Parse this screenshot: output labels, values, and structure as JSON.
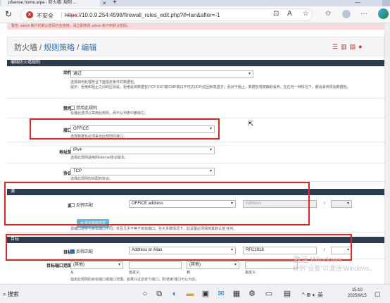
{
  "browser": {
    "tab_title": "pfsense.home.arpa - 防火墙: 规则 ...",
    "tab_close": "×",
    "new_tab": "+",
    "window_minimize": "—",
    "security_label": "不安全",
    "url_scheme": "https",
    "url_rest": "://10.0.9.254:4598/firewall_rules_edit.php?if=lan&after=-1"
  },
  "alert": {
    "text": "警告: admin 帐户的默认密码仍在使用。请立即修改 admin 帐户的默认密码。"
  },
  "breadcrumb": {
    "root": "防火墙",
    "sep": " / ",
    "rules": "规则策略",
    "current": "编辑"
  },
  "section_edit": {
    "title": "编辑防火墙规则",
    "action": {
      "label": "动作",
      "value": "通过",
      "help1": "选择如何处理符合下面指定条件的数据包。",
      "help2": "提示：拒绝和阻止之间的区别是，拒绝是将数据包(TCP RST或ICMP端口不可达UDP)返回到发送方；而对于阻止，数据包将被静默丢弃。在任何一种情况下，都会丢弃原始数据包。"
    },
    "disabled": {
      "label": "禁用",
      "checkbox": "禁用此规则",
      "help": "设置此选项以禁用此规则，而不从列表中删除它。"
    },
    "interface": {
      "label": "接口",
      "value": "OFFICE",
      "help": "选择数据包必须来自此规则的接口。"
    },
    "address_family": {
      "label": "地址族",
      "value": "IPv4",
      "help": "选择此规则适用的Internet协议版本。"
    },
    "protocol": {
      "label": "协议",
      "value": "TCP",
      "help": "选择此规则应匹配的协议。"
    }
  },
  "section_source": {
    "title": "源",
    "label": "源",
    "invert": "反转匹配",
    "type": "OFFICE address",
    "address_placeholder": "Address",
    "mask_sep": "/",
    "advanced_button": "显示高级选项",
    "help": "源端口通常与目标端口不同，并且几乎不等于目标端口。在大多数情况下，此设置必须保持其默认值 任何。"
  },
  "section_dest": {
    "title": "目标",
    "label": "目标",
    "invert": "反转匹配",
    "type": "Address or Alias",
    "address": "RFC1918",
    "mask_sep": "/",
    "port_label": "目标端口范围",
    "from_value": "(其他)",
    "from_text": "从",
    "custom1": "自定义",
    "to_value": "(其他)",
    "to_text": "到",
    "custom2": "自定义",
    "help": "指定此规则的目标端口或端口范围。如果只过滤单个端口，则‘结束’端口可以为空。"
  },
  "watermark": {
    "line1": "激活 Windows",
    "line2": "转到\"设置\"以激活 Windows。"
  },
  "taskbar": {
    "search": "搜索",
    "ime": "英",
    "time": "15:10",
    "date": "2025/9/15"
  }
}
